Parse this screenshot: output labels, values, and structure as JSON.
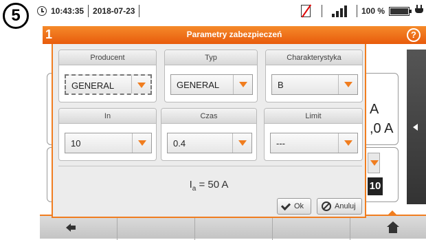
{
  "step": "5",
  "status": {
    "time": "10:43:35",
    "date": "2018-07-23",
    "battery": "100 %"
  },
  "titlebar": {
    "number": "1",
    "title": "Parametry zabezpieczeń",
    "help": "?"
  },
  "dialog": {
    "producent": {
      "label": "Producent",
      "value": "GENERAL"
    },
    "typ": {
      "label": "Typ",
      "value": "GENERAL"
    },
    "charakterystyka": {
      "label": "Charakterystyka",
      "value": "B"
    },
    "in": {
      "label": "In",
      "value": "10"
    },
    "czas": {
      "label": "Czas",
      "value": "0.4"
    },
    "limit": {
      "label": "Limit",
      "value": "---"
    },
    "result": {
      "symbol": "I",
      "subscript": "a",
      "value": " = 50 A"
    },
    "ok_label": "Ok",
    "cancel_label": "Anuluj"
  },
  "background": {
    "value1": "A",
    "value2": ",0 A",
    "value3": "10"
  }
}
